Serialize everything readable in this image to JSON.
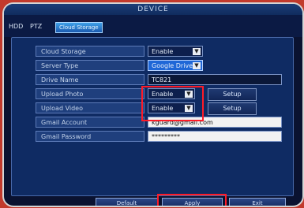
{
  "window": {
    "title": "DEVICE"
  },
  "tabs": [
    {
      "label": "HDD"
    },
    {
      "label": "PTZ"
    },
    {
      "label": "Cloud Storage"
    }
  ],
  "rows": [
    {
      "label": "Cloud Storage",
      "value": "Enable"
    },
    {
      "label": "Server Type",
      "value": "Google Drive"
    },
    {
      "label": "Drive Name",
      "value": "TC821"
    },
    {
      "label": "Upload Photo",
      "value": "Enable"
    },
    {
      "label": "Upload Video",
      "value": "Enable"
    },
    {
      "label": "Gmail Account",
      "value": "kguard@gmail.com"
    },
    {
      "label": "Gmail Password",
      "value": "*********"
    }
  ],
  "setup_label": "Setup",
  "footer": {
    "default": "Default",
    "apply": "Apply",
    "exit": "Exit"
  }
}
